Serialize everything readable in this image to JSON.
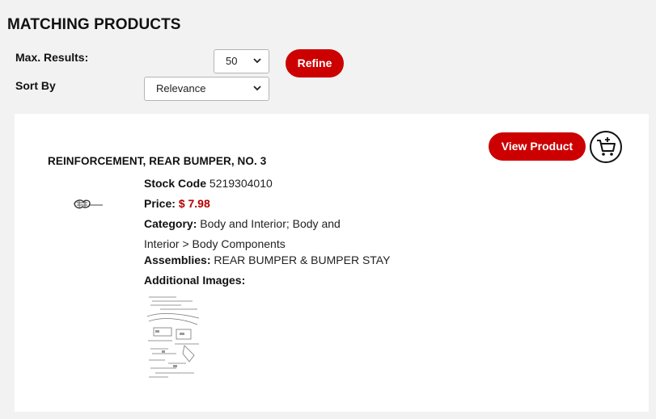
{
  "page": {
    "title": "MATCHING PRODUCTS"
  },
  "filters": {
    "max_results_label": "Max. Results:",
    "max_results_value": "50",
    "sort_by_label": "Sort By",
    "sort_by_value": "Relevance",
    "refine_label": "Refine"
  },
  "product": {
    "name": "REINFORCEMENT, REAR BUMPER, NO. 3",
    "view_label": "View Product",
    "stock_code_label": "Stock Code",
    "stock_code": "5219304010",
    "price_label": "Price:",
    "price": "$ 7.98",
    "category_label": "Category",
    "category_line1": "Body and Interior; Body and",
    "category_line2": "Interior > Body Components",
    "assemblies_label": "Assemblies:",
    "assemblies": "REAR BUMPER & BUMPER STAY",
    "additional_images_label": "Additional Images:"
  },
  "colors": {
    "accent": "#cc0000",
    "price": "#b40000",
    "background": "#f2f2f2"
  },
  "icons": {
    "cart": "add-to-cart-icon",
    "dropdown": "chevron-down-icon"
  }
}
